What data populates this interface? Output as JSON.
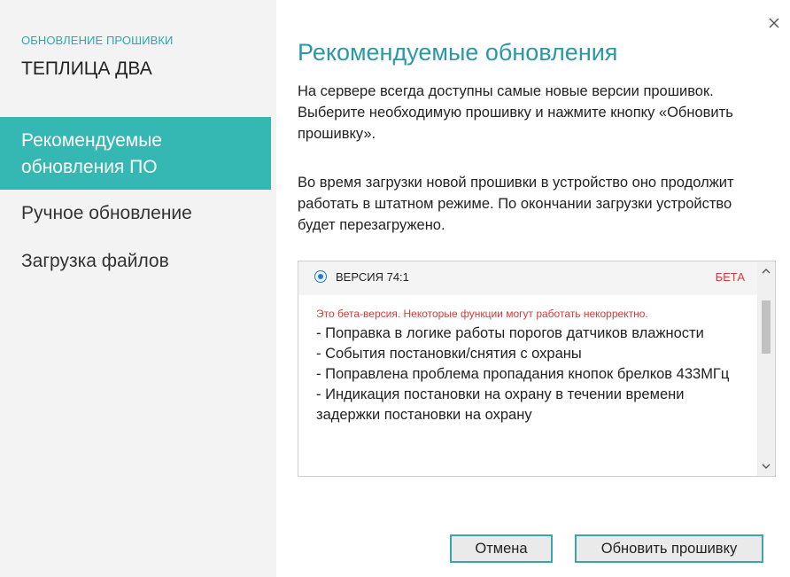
{
  "sidebar": {
    "subtitle": "ОБНОВЛЕНИЕ ПРОШИВКИ",
    "title": "ТЕПЛИЦА ДВА",
    "items": [
      {
        "label_line1": "Рекомендуемые",
        "label_line2": "обновления ПО",
        "active": true
      },
      {
        "label": "Ручное обновление",
        "active": false
      },
      {
        "label": "Загрузка файлов",
        "active": false
      }
    ]
  },
  "main": {
    "heading": "Рекомендуемые обновления",
    "paragraph1": "На сервере всегда доступны самые новые версии прошивок. Выберите необходимую прошивку и нажмите кнопку «Обновить прошивку».",
    "paragraph2": "Во время загрузки новой прошивки в устройство оно продолжит работать в штатном режиме. По окончании загрузки устройство будет перезагружено.",
    "versions": [
      {
        "label": "ВЕРСИЯ 74:1",
        "badge": "БЕТА",
        "selected": true,
        "warning": "Это бета-версия. Некоторые функции могут работать некорректно.",
        "changes": [
          "- Поправка в логике работы порогов датчиков влажности",
          "- События постановки/снятия с охраны",
          "- Поправлена проблема пропадания кнопок брелков 433МГц",
          "- Индикация постановки на охрану в течении времени задержки постановки на охрану"
        ]
      }
    ]
  },
  "buttons": {
    "cancel": "Отмена",
    "update": "Обновить прошивку"
  },
  "icons": {
    "close": "close-icon",
    "scroll_up": "chevron-up-icon",
    "scroll_down": "chevron-down-icon"
  },
  "colors": {
    "accent": "#35b7b4",
    "heading": "#2a98a8",
    "beta": "#d43b3b",
    "radio": "#1d7fd0",
    "sidebar_bg": "#f3f3f3"
  }
}
